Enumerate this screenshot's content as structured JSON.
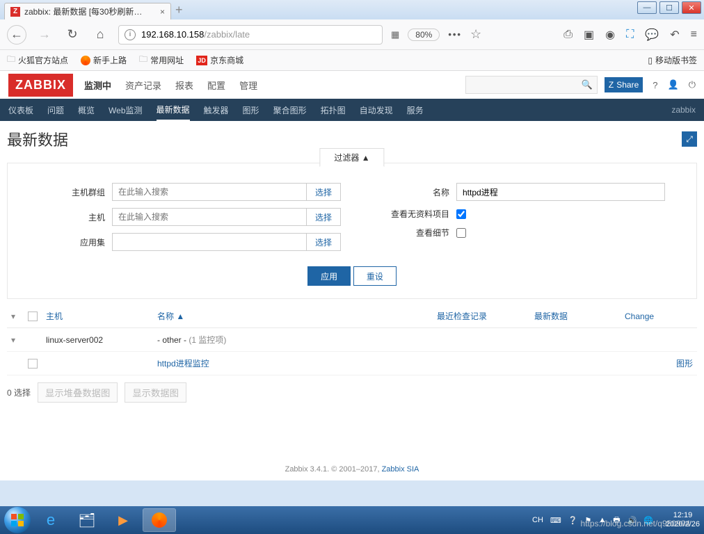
{
  "window": {
    "tab_title": "zabbix: 最新数据 [每30秒刷新…"
  },
  "browser": {
    "url_host": "192.168.10.158",
    "url_path": "/zabbix/late",
    "zoom": "80%"
  },
  "bookmarks": {
    "b1": "火狐官方站点",
    "b2": "新手上路",
    "b3": "常用网址",
    "b4": "京东商城",
    "mobile": "移动版书签"
  },
  "zabbix": {
    "menu": {
      "m1": "监测中",
      "m2": "资产记录",
      "m3": "报表",
      "m4": "配置",
      "m5": "管理"
    },
    "share": "Share",
    "submenu": {
      "s1": "仪表板",
      "s2": "问题",
      "s3": "概览",
      "s4": "Web监测",
      "s5": "最新数据",
      "s6": "触发器",
      "s7": "图形",
      "s8": "聚合图形",
      "s9": "拓扑图",
      "s10": "自动发现",
      "s11": "服务",
      "right": "zabbix"
    },
    "page_title": "最新数据",
    "filter": {
      "tab": "过滤器 ▲",
      "host_group_label": "主机群组",
      "host_group_ph": "在此输入搜索",
      "host_label": "主机",
      "host_ph": "在此输入搜索",
      "app_label": "应用集",
      "name_label": "名称",
      "name_value": "httpd进程",
      "empty_label": "查看无资料项目",
      "detail_label": "查看细节",
      "select": "选择",
      "apply": "应用",
      "reset": "重设"
    },
    "table": {
      "h_host": "主机",
      "h_name": "名称 ▲",
      "h_last": "最近检查记录",
      "h_latest": "最新数据",
      "h_change": "Change",
      "row1_host": "linux-server002",
      "row1_app": "- other -",
      "row1_count": "(1 监控项)",
      "row2_name": "httpd进程监控",
      "row2_graph": "图形"
    },
    "footer": {
      "selected": "0 选择",
      "btn1": "显示堆叠数据图",
      "btn2": "显示数据图"
    },
    "copyright": "Zabbix 3.4.1. © 2001–2017, ",
    "sia": "Zabbix SIA"
  },
  "taskbar": {
    "ime": "CH",
    "time": "12:19",
    "date": "2020/2/26"
  },
  "watermark": "https://blog.csdn.net/q950904"
}
